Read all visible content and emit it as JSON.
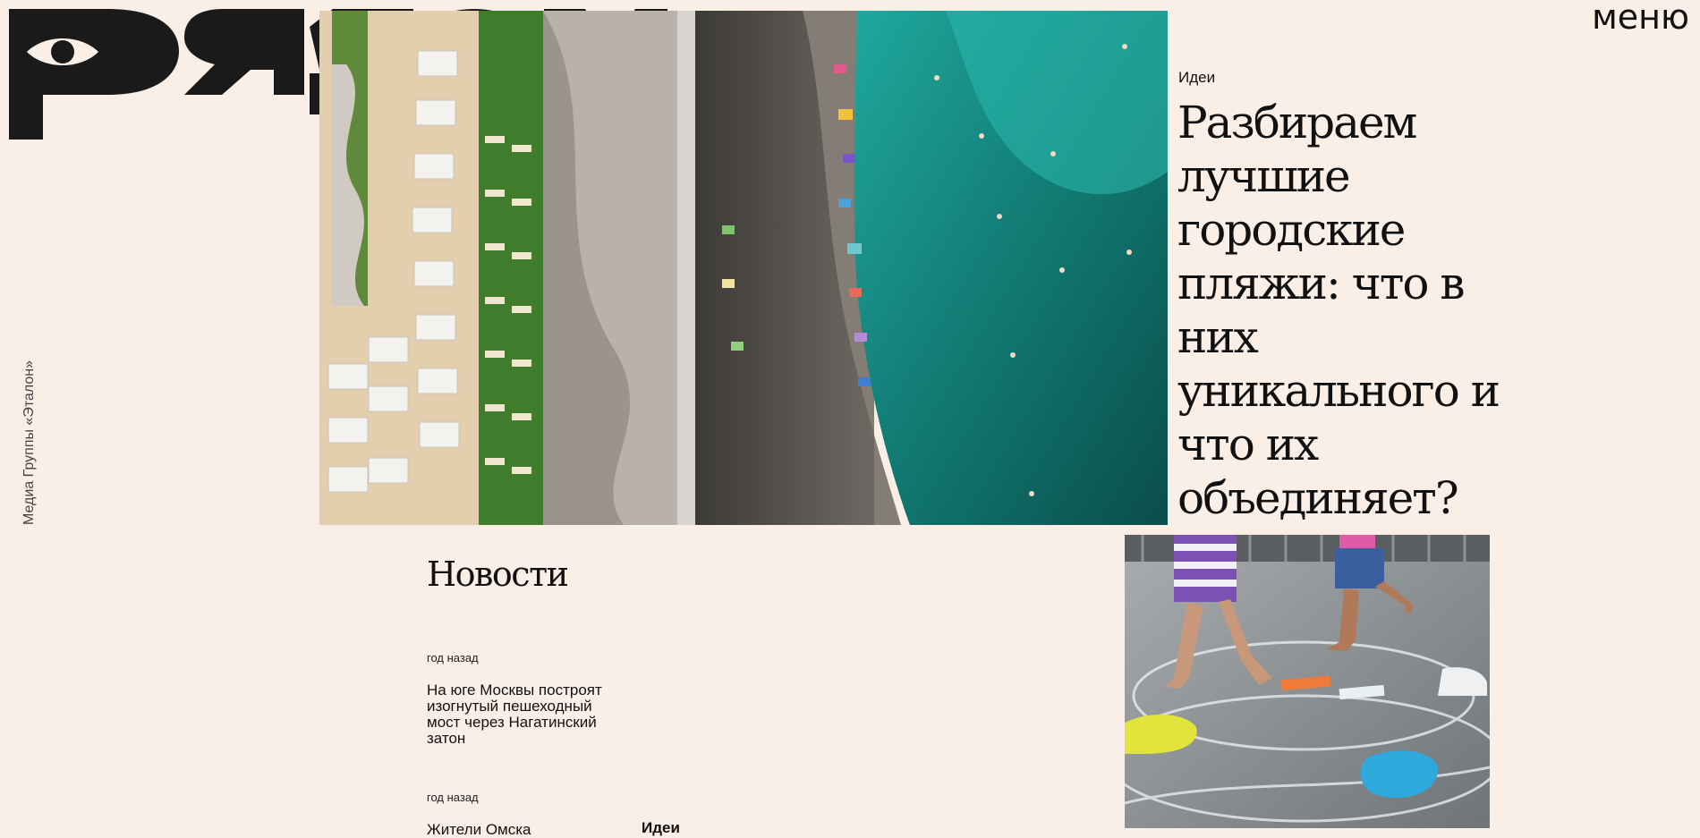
{
  "brand": {
    "logo_text": "рядом"
  },
  "header": {
    "menu_label": "меню"
  },
  "side": {
    "text": "Медиа Группы «Эталон»"
  },
  "hero": {
    "category": "Идеи",
    "title": "Разбираем лучшие городские пляжи: что в них уникального и что их объединяет?"
  },
  "news": {
    "heading": "Новости",
    "items": [
      {
        "time": "год назад",
        "title": "На юге Москвы построят изогнутый пешеходный мост через Нагатинский затон"
      },
      {
        "time": "год назад",
        "title": "Жители Омска"
      }
    ]
  },
  "secondary": {
    "category_partial": "Идеи"
  },
  "colors": {
    "background": "#f9efe7",
    "text": "#111111"
  }
}
